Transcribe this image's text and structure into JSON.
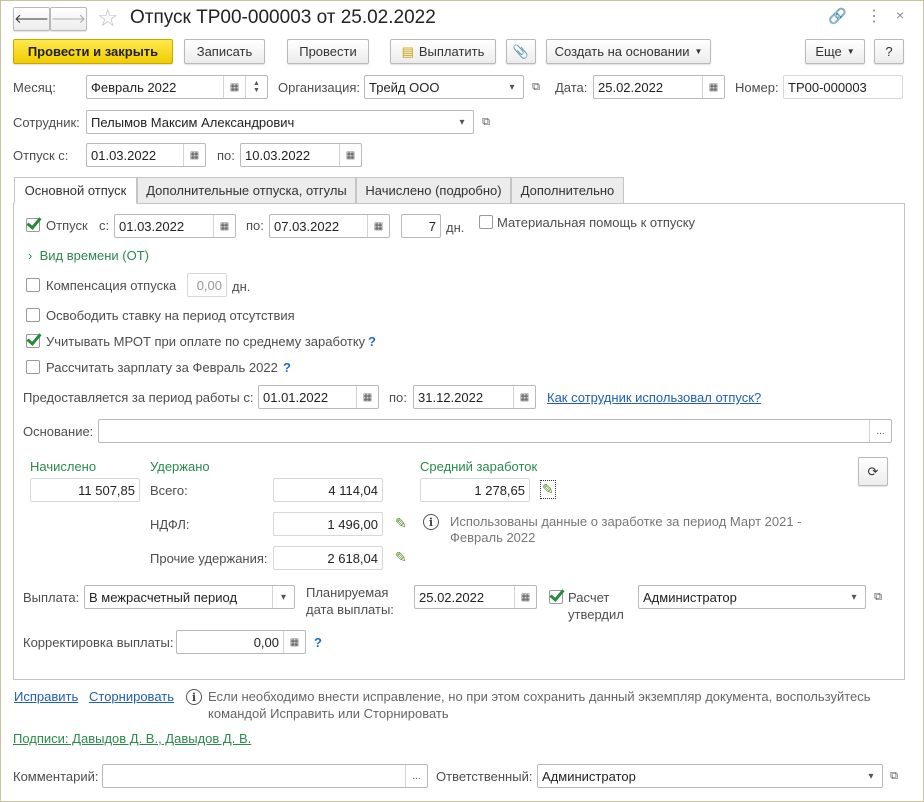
{
  "window": {
    "title": "Отпуск ТР00-000003 от 25.02.2022"
  },
  "toolbar": {
    "post_close": "Провести и закрыть",
    "save": "Записать",
    "post": "Провести",
    "pay": "Выплатить",
    "create_based": "Создать на основании",
    "more": "Еще",
    "help": "?"
  },
  "header": {
    "month_label": "Месяц:",
    "month": "Февраль 2022",
    "org_label": "Организация:",
    "org": "Трейд ООО",
    "date_label": "Дата:",
    "date": "25.02.2022",
    "number_label": "Номер:",
    "number": "ТР00-000003",
    "employee_label": "Сотрудник:",
    "employee": "Пелымов Максим Александрович",
    "vac_from_label": "Отпуск с:",
    "vac_from": "01.03.2022",
    "vac_to_label": "по:",
    "vac_to": "10.03.2022"
  },
  "tabs": [
    "Основной отпуск",
    "Дополнительные отпуска, отгулы",
    "Начислено (подробно)",
    "Дополнительно"
  ],
  "main": {
    "vacation_label": "Отпуск",
    "from_label": "с:",
    "from": "01.03.2022",
    "to_label": "по:",
    "to": "07.03.2022",
    "days": "7",
    "days_unit": "дн.",
    "material_aid": "Материальная помощь к отпуску",
    "time_kind": "Вид времени (ОТ)",
    "compensation": "Компенсация отпуска",
    "comp_days": "0,00",
    "comp_unit": "дн.",
    "free_rate": "Освободить ставку на период отсутствия",
    "mrot": "Учитывать МРОТ при оплате по среднему заработку",
    "calc_salary": "Рассчитать зарплату за Февраль 2022",
    "q": "?",
    "period_label": "Предоставляется за период работы с:",
    "period_from": "01.01.2022",
    "period_to_label": "по:",
    "period_to": "31.12.2022",
    "usage_link": "Как сотрудник использовал отпуск?",
    "basis_label": "Основание:",
    "basis": "",
    "accrued_label": "Начислено",
    "accrued": "11 507,85",
    "withheld_label": "Удержано",
    "total_label": "Всего:",
    "total": "4 114,04",
    "ndfl_label": "НДФЛ:",
    "ndfl": "1 496,00",
    "other_label": "Прочие удержания:",
    "other": "2 618,04",
    "avg_label": "Средний заработок",
    "avg": "1 278,65",
    "avg_info": "Использованы данные о заработке за период Март 2021 -",
    "avg_info2": "Февраль 2022",
    "payout_label": "Выплата:",
    "payout": "В межрасчетный период",
    "planned_label1": "Планируемая",
    "planned_label2": "дата выплаты:",
    "planned": "25.02.2022",
    "approved_label1": "Расчет",
    "approved_label2": "утвердил",
    "approved_by": "Администратор",
    "correction_label": "Корректировка выплаты:",
    "correction": "0,00"
  },
  "footer": {
    "fix": "Исправить",
    "reverse": "Сторнировать",
    "note1": "Если необходимо внести исправление, но при этом сохранить данный экземпляр документа, воспользуйтесь",
    "note2": "командой Исправить или Сторнировать",
    "signatures": "Подписи: Давыдов Д. В., Давыдов Д. В.",
    "comment_label": "Комментарий:",
    "comment": "",
    "responsible_label": "Ответственный:",
    "responsible": "Администратор"
  },
  "colors": {
    "accent": "#f0cc00",
    "green": "#2a8a4b",
    "link": "#1f5fb5"
  }
}
